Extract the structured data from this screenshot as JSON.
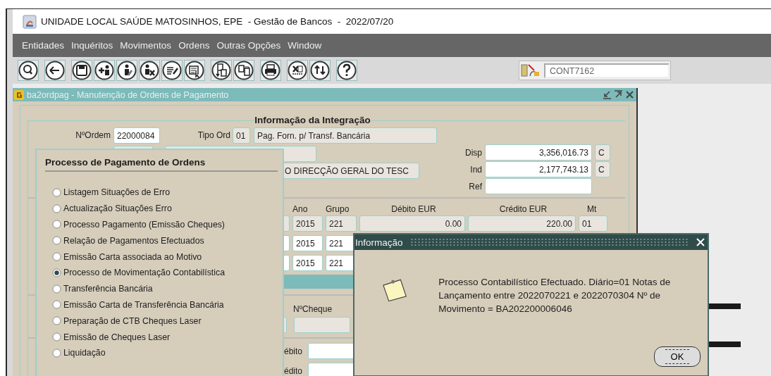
{
  "window": {
    "title": "UNIDADE LOCAL SAÚDE MATOSINHOS, EPE  - Gestão de Bancos  -  2022/07/20"
  },
  "menu": [
    "Entidades",
    "Inquéritos",
    "Movimentos",
    "Ordens",
    "Outras Opções",
    "Window"
  ],
  "user_field": {
    "value": "CONT7162"
  },
  "form_window": {
    "title": "ba2ordpag - Manutenção de Ordens de Pagamento",
    "heading": "Informação da Integração",
    "order_label": "NºOrdem",
    "order_no": "22000084",
    "type_label": "Tipo Ord",
    "type_code": "01",
    "type_name": "Pag. Forn. p/ Transf. Bancária",
    "entity_name": "O DIRECÇÃO GERAL DO TESC",
    "balances": [
      {
        "label": "Disp",
        "value": "3,356,016.73",
        "flag": "C"
      },
      {
        "label": "Ind",
        "value": "2,177,743.13",
        "flag": "C"
      },
      {
        "label": "Ref"
      }
    ],
    "columns": [
      "Ano",
      "Grupo",
      "Débito EUR",
      "Crédito EUR",
      "Mt"
    ],
    "rows": [
      {
        "readonly": true,
        "ano": "2015",
        "grupo": "221",
        "debito": "0.00",
        "credito": "220.00",
        "mt": "01"
      },
      {
        "readonly": false,
        "ano": "2015",
        "grupo": "221"
      },
      {
        "readonly": false,
        "ano": "2015",
        "grupo": "221"
      }
    ],
    "cheque_label": "NºCheque",
    "debit_label": "ébito",
    "credit_label": "édito"
  },
  "process_panel": {
    "title": "Processo de Pagamento de Ordens",
    "options": [
      {
        "label": "Listagem Situações de Erro",
        "selected": false
      },
      {
        "label": "Actualização Situações Erro",
        "selected": false
      },
      {
        "label": "Processo Pagamento (Emissão Cheques)",
        "selected": false
      },
      {
        "label": "Relação de Pagamentos Efectuados",
        "selected": false
      },
      {
        "label": "Emissão Carta associada ao Motivo",
        "selected": false
      },
      {
        "label": "Processo de Movimentação Contabilística",
        "selected": true
      },
      {
        "label": "Transferência Bancária",
        "selected": false
      },
      {
        "label": "Emissão Carta de Transferência Bancária",
        "selected": false
      },
      {
        "label": "Preparação de CTB Cheques Laser",
        "selected": false
      },
      {
        "label": "Emissão de Cheques Laser",
        "selected": false
      },
      {
        "label": "Liquidação",
        "selected": false
      }
    ]
  },
  "message_box": {
    "title": "Informação",
    "message": "Processo Contabilístico Efectuado. Diário=01 Notas de Lançamento entre 2022070221 e 2022070304  Nº de Movimento = BA202200006046",
    "ok_button": "OK"
  }
}
